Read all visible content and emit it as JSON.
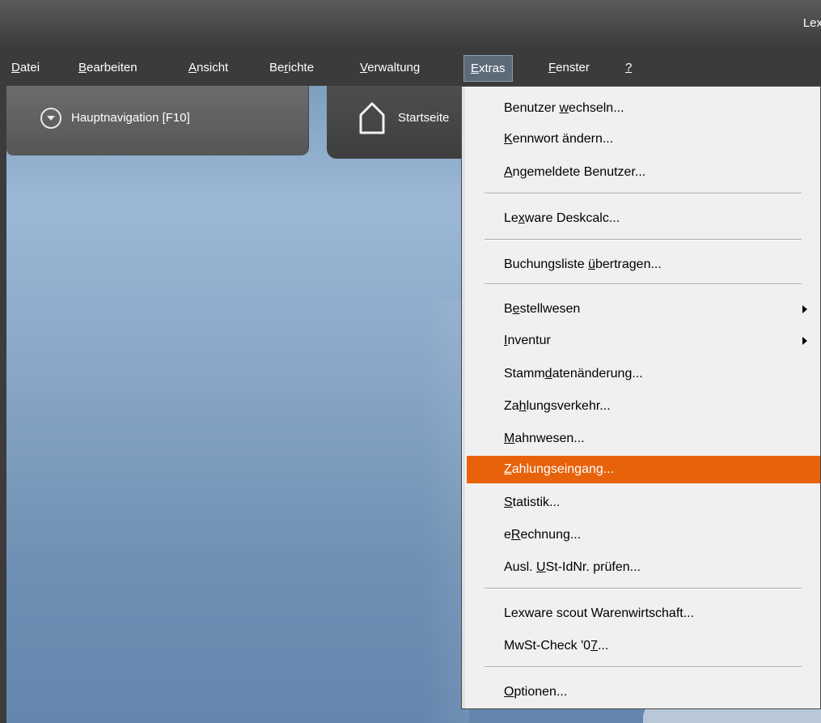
{
  "window": {
    "title": "Lex"
  },
  "menubar": {
    "items": [
      {
        "pre": "",
        "acc": "D",
        "post": "atei"
      },
      {
        "pre": "",
        "acc": "B",
        "post": "earbeiten"
      },
      {
        "pre": "",
        "acc": "A",
        "post": "nsicht"
      },
      {
        "pre": "Be",
        "acc": "r",
        "post": "ichte"
      },
      {
        "pre": "",
        "acc": "V",
        "post": "erwaltung"
      },
      {
        "pre": "",
        "acc": "E",
        "post": "xtras"
      },
      {
        "pre": "",
        "acc": "F",
        "post": "enster"
      },
      {
        "pre": "",
        "acc": "?",
        "post": ""
      }
    ]
  },
  "tabs": {
    "hauptnavigation": "Hauptnavigation [F10]",
    "startseite": "Startseite"
  },
  "extras_menu": {
    "items": [
      {
        "pre": "Benutzer ",
        "acc": "w",
        "post": "echseln..."
      },
      {
        "pre": "",
        "acc": "K",
        "post": "ennwort ändern..."
      },
      {
        "pre": "",
        "acc": "A",
        "post": "ngemeldete Benutzer..."
      },
      {
        "pre": "Le",
        "acc": "x",
        "post": "ware Deskcalc..."
      },
      {
        "pre": "Buchungsliste ",
        "acc": "ü",
        "post": "bertragen..."
      },
      {
        "pre": "B",
        "acc": "e",
        "post": "stellwesen"
      },
      {
        "pre": "",
        "acc": "I",
        "post": "nventur"
      },
      {
        "pre": "Stamm",
        "acc": "d",
        "post": "atenänderung..."
      },
      {
        "pre": "Za",
        "acc": "h",
        "post": "lungsverkehr..."
      },
      {
        "pre": "",
        "acc": "M",
        "post": "ahnwesen..."
      },
      {
        "pre": "",
        "acc": "Z",
        "post": "ahlungseingang..."
      },
      {
        "pre": "",
        "acc": "S",
        "post": "tatistik..."
      },
      {
        "pre": "e",
        "acc": "R",
        "post": "echnung..."
      },
      {
        "pre": "Ausl. ",
        "acc": "U",
        "post": "St-IdNr. prüfen..."
      },
      {
        "pre": "Lexware scout Warenwirtschaft...",
        "acc": "",
        "post": ""
      },
      {
        "pre": "MwSt-Check '0",
        "acc": "7",
        "post": "..."
      },
      {
        "pre": "",
        "acc": "O",
        "post": "ptionen..."
      }
    ]
  },
  "colors": {
    "highlight": "#e8620c",
    "menubar": "#3b3b3b",
    "active_menu": "#5d6b79"
  }
}
